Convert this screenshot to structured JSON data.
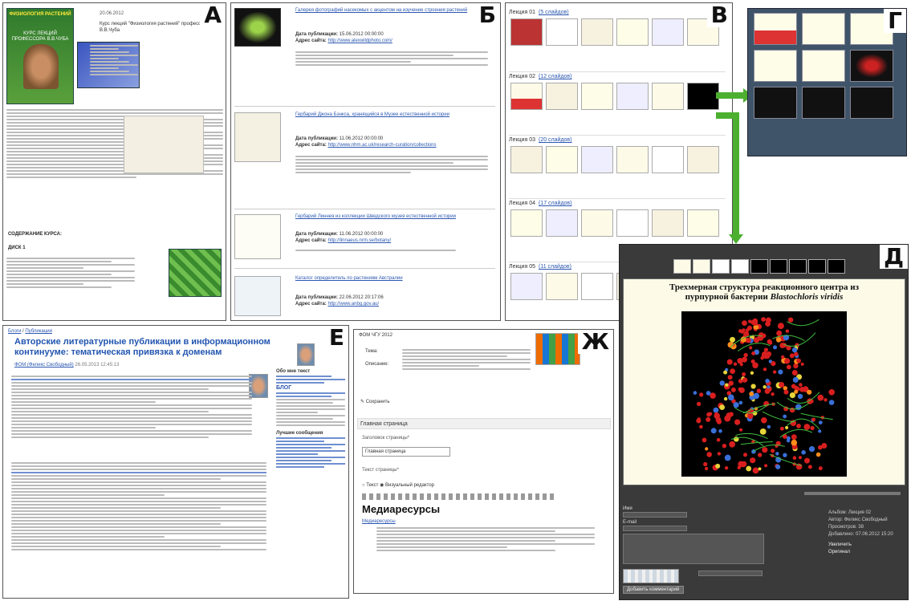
{
  "panels": {
    "a": {
      "tag": "А",
      "date": "20.06.2012",
      "title": "Курс лекций \"Физиология растений\" профессора В.В.Чуба",
      "book_title": "ФИЗИОЛОГИЯ РАСТЕНИЙ",
      "book_sub": "КУРС ЛЕКЦИЙ ПРОФЕССОРА В.В.ЧУБА",
      "section": "СОДЕРЖАНИЕ КУРСА:",
      "disk": "ДИСК 1"
    },
    "b": {
      "tag": "Б",
      "items": [
        {
          "title": "Галерея фотографий насекомых с акцентом на изучение строения растений",
          "date_label": "Дата публикации:",
          "date": "15.06.2012 00:00:00",
          "site_label": "Адрес сайта:",
          "site": "http://www.alexwildphoto.com/"
        },
        {
          "title": "Гербарий Джона Бэнкса, хранящийся в Музее естественной истории",
          "date_label": "Дата публикации:",
          "date": "11.06.2012 00:00:00",
          "site_label": "Адрес сайта:",
          "site": "http://www.nhm.ac.uk/research-curation/collections"
        },
        {
          "title": "Гербарий Линнея из коллекции Шведского музея естественной истории",
          "date_label": "Дата публикации:",
          "date": "11.06.2012 00:00:00",
          "site_label": "Адрес сайта:",
          "site": "http://linnaeus.nrm.se/botany/"
        },
        {
          "title": "Каталог определитель по растениям Австралии",
          "date_label": "Дата публикации:",
          "date": "22.06.2012 20:17:06",
          "site_label": "Адрес сайта:",
          "site": "http://www.anbg.gov.au/"
        }
      ]
    },
    "v": {
      "tag": "В",
      "rows": [
        {
          "label": "Лекция 01",
          "count": "(5 слайдов)"
        },
        {
          "label": "Лекция 02",
          "count": "(12 слайдов)"
        },
        {
          "label": "Лекция 03",
          "count": "(20 слайдов)"
        },
        {
          "label": "Лекция 04",
          "count": "(17 слайдов)"
        },
        {
          "label": "Лекция 05",
          "count": "(11 слайдов)"
        }
      ]
    },
    "g": {
      "tag": "Г"
    },
    "d": {
      "tag": "Д",
      "heading_line1": "Трехмерная структура реакционного центра из",
      "heading_line2_plain": "пурпурной бактерии ",
      "heading_line2_italic": "Blastochloris viridis",
      "form_name": "Имя",
      "form_email": "E-mail",
      "form_submit": "Добавить комментарий",
      "meta_lecture": "Альбом: Лекция 02",
      "meta_author": "Автор: Феликс Свободный",
      "meta_views": "Просмотров: 38",
      "meta_added": "Добавлено: 07.06.2012 15:20",
      "meta_enlarge": "Увеличить",
      "meta_original": "Оригинал"
    },
    "e": {
      "tag": "Е",
      "breadcrumb_home": "Блоги",
      "breadcrumb_sep": "/",
      "breadcrumb_sub": "Публикации",
      "title": "Авторские литературные публикации в информационном континууме: тематическая привязка к доменам",
      "author": "ФОМ (Феликс Свободный)",
      "date": "26.05.2013 12:45:13",
      "sidebar_head": "Обо мне текст",
      "sidebar_blog": "БЛОГ",
      "sidebar_recent": "Лучшие сообщения"
    },
    "zh": {
      "tag": "Ж",
      "course": "ФОМ ЧГУ 2012",
      "name_label": "Тема:",
      "desc_label": "Описание:",
      "save": "Сохранить",
      "page_header": "Главная страница",
      "field_label": "Заголовок страницы*",
      "field_value": "Главная страница",
      "text_label": "Текст страницы*",
      "radio_text": "Текст",
      "radio_editor": "Визуальный редактор",
      "editor_heading": "Медиаресурсы",
      "editor_intro_link": "Медиаресурсы"
    }
  },
  "colors": {
    "arrow": "#4caf30",
    "g_bg": "#3f5468",
    "d_bg": "#3a3a3a",
    "link": "#2b57b0",
    "red_atom": "#d81e1e"
  }
}
